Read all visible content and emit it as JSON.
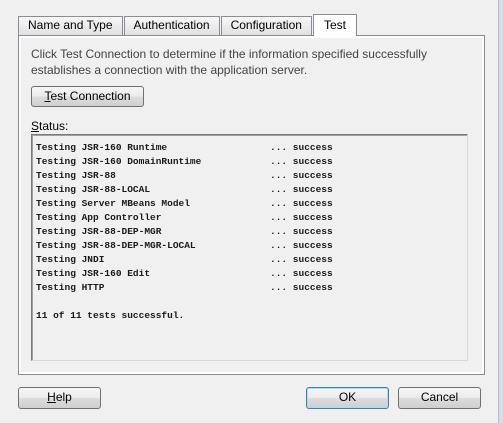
{
  "tabs": [
    {
      "label": "Name and Type",
      "active": false
    },
    {
      "label": "Authentication",
      "active": false
    },
    {
      "label": "Configuration",
      "active": false
    },
    {
      "label": "Test",
      "active": true
    }
  ],
  "test_panel": {
    "description": "Click Test Connection to determine if the information specified successfully establishes a connection with the application server.",
    "test_button": {
      "mnemonic": "T",
      "rest": "est Connection"
    },
    "status_label": {
      "mnemonic": "S",
      "rest": "tatus:"
    },
    "results": [
      {
        "name": "Testing JSR-160 Runtime",
        "result": "... success"
      },
      {
        "name": "Testing JSR-160 DomainRuntime",
        "result": "... success"
      },
      {
        "name": "Testing JSR-88",
        "result": "... success"
      },
      {
        "name": "Testing JSR-88-LOCAL",
        "result": "... success"
      },
      {
        "name": "Testing Server MBeans Model",
        "result": "... success"
      },
      {
        "name": "Testing App Controller",
        "result": "... success"
      },
      {
        "name": "Testing JSR-88-DEP-MGR",
        "result": "... success"
      },
      {
        "name": "Testing JSR-88-DEP-MGR-LOCAL",
        "result": "... success"
      },
      {
        "name": "Testing JNDI",
        "result": "... success"
      },
      {
        "name": "Testing JSR-160 Edit",
        "result": "... success"
      },
      {
        "name": "Testing HTTP",
        "result": "... success"
      }
    ],
    "summary": "11 of 11 tests successful."
  },
  "footer": {
    "help": {
      "mnemonic": "H",
      "rest": "elp"
    },
    "ok": "OK",
    "cancel": "Cancel"
  }
}
